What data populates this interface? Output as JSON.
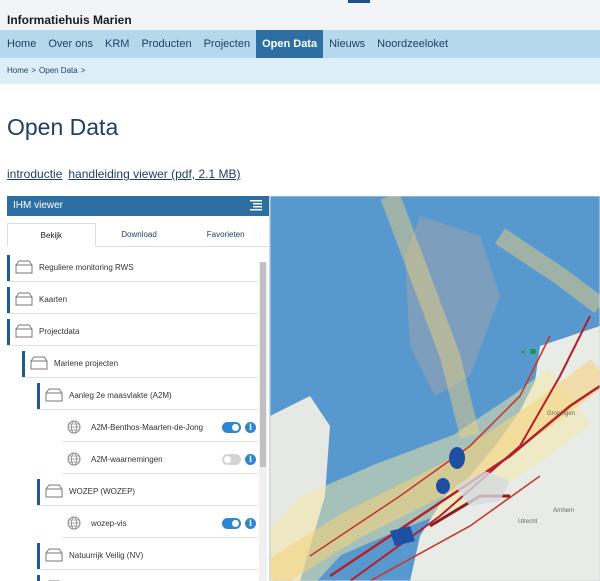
{
  "site": {
    "title": "Informatiehuis Marien"
  },
  "nav": {
    "items": [
      "Home",
      "Over ons",
      "KRM",
      "Producten",
      "Projecten",
      "Open Data",
      "Nieuws",
      "Noordzeeloket"
    ],
    "active": "Open Data"
  },
  "breadcrumb": {
    "items": [
      "Home",
      "Open Data"
    ],
    "separator": ">"
  },
  "page": {
    "title": "Open Data"
  },
  "links": {
    "intro": "introductie",
    "manual": "handleiding viewer (pdf, 2.1 MB)"
  },
  "viewer": {
    "title": "IHM viewer",
    "tabs": [
      "Bekijk",
      "Download",
      "Favorieten"
    ],
    "active_tab": "Bekijk",
    "tree": [
      {
        "label": "Reguliere monitoring RWS",
        "type": "folder",
        "level": 0
      },
      {
        "label": "Kaarten",
        "type": "folder",
        "level": 0
      },
      {
        "label": "Projectdata",
        "type": "folder",
        "level": 0
      },
      {
        "label": "Mariene projecten",
        "type": "folder",
        "level": 1
      },
      {
        "label": "Aanleg 2e maasvlakte (A2M)",
        "type": "folder",
        "level": 2
      },
      {
        "label": "A2M-Benthos-Maarten-de-Jong",
        "type": "layer",
        "level": 3,
        "enabled": true
      },
      {
        "label": "A2M-waarnemingen",
        "type": "layer",
        "level": 3,
        "enabled": false
      },
      {
        "label": "WOZEP (WOZEP)",
        "type": "folder",
        "level": 2
      },
      {
        "label": "wozep-vis",
        "type": "layer",
        "level": 3,
        "enabled": true
      },
      {
        "label": "Natuurrijk Veilig (NV)",
        "type": "folder",
        "level": 2
      },
      {
        "label": "",
        "type": "folder",
        "level": 2
      }
    ],
    "info_symbol": "i",
    "collapse_symbol": "◂"
  },
  "map": {
    "labels": [
      "Groningen",
      "Utrecht",
      "Arnhem"
    ]
  },
  "colors": {
    "accent": "#2d6fa3",
    "nav_bg": "#b6d8ec",
    "toggle_on": "#2d86d1"
  }
}
